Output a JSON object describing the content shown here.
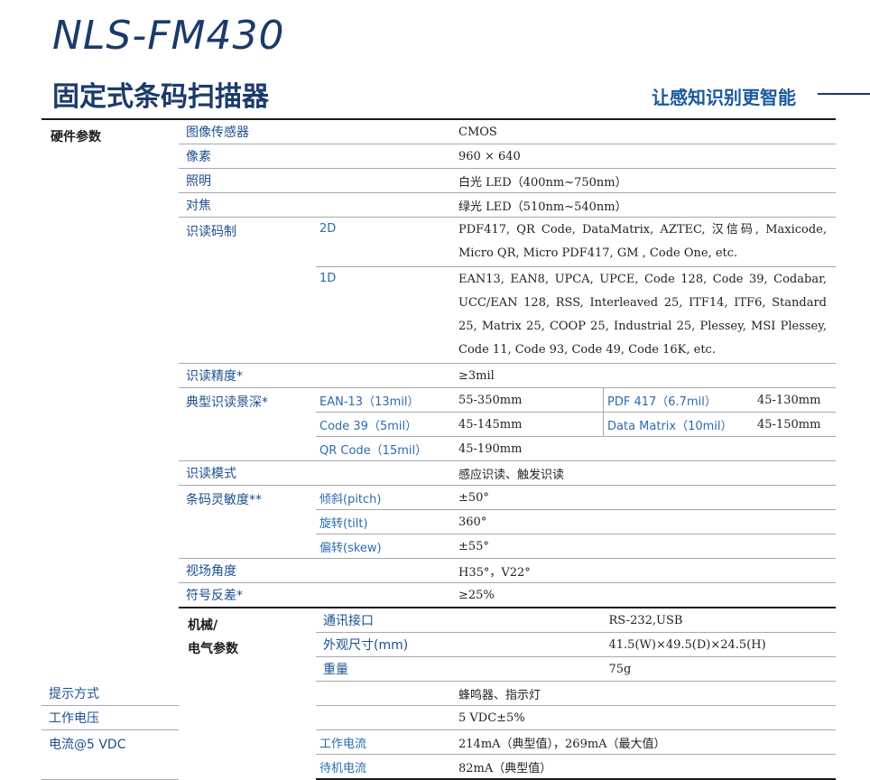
{
  "header": {
    "model": "NLS-FM430",
    "subtitle": "固定式条码扫描器",
    "slogan": "让感知识别更智能"
  },
  "groups": {
    "hardware": "硬件参数",
    "mech_line1": "机械/",
    "mech_line2": "电气参数"
  },
  "rows": {
    "sensor": {
      "label": "图像传感器",
      "value": "CMOS"
    },
    "pixels": {
      "label": "像素",
      "value": "960 × 640"
    },
    "illumination": {
      "label": "照明",
      "value": "白光 LED（400nm~750nm）"
    },
    "aiming": {
      "label": "对焦",
      "value": "绿光 LED（510nm~540nm）"
    },
    "symbologies": {
      "label": "识读码制",
      "sub2d": "2D",
      "value2d": "PDF417, QR Code, DataMatrix, AZTEC, 汉信码, Maxicode, Micro QR, Micro PDF417, GM , Code One, etc.",
      "sub1d": "1D",
      "value1d": "EAN13, EAN8, UPCA, UPCE, Code 128, Code 39, Codabar, UCC/EAN 128, RSS, Interleaved 25, ITF14, ITF6, Standard 25, Matrix 25, COOP 25, Industrial 25, Plessey, MSI Plessey, Code 11, Code 93, Code 49, Code 16K, etc."
    },
    "resolution": {
      "label": "识读精度*",
      "value": "≥3mil"
    },
    "dof": {
      "label": "典型识读景深*",
      "r1_sub": "EAN-13（13mil）",
      "r1_val": "55-350mm",
      "r1_sub_b": "PDF 417（6.7mil）",
      "r1_val_b": "45-130mm",
      "r2_sub": "Code 39（5mil）",
      "r2_val": "45-145mm",
      "r2_sub_b": "Data Matrix（10mil）",
      "r2_val_b": "45-150mm",
      "r3_sub": "QR Code（15mil）",
      "r3_val": "45-190mm"
    },
    "scan_mode": {
      "label": "识读模式",
      "value": "感应识读、触发识读"
    },
    "sensitivity": {
      "label": "条码灵敏度**",
      "pitch_sub": "倾斜(pitch)",
      "pitch_val": "±50°",
      "tilt_sub": "旋转(tilt)",
      "tilt_val": "360°",
      "skew_sub": "偏转(skew)",
      "skew_val": "±55°"
    },
    "fov": {
      "label": "视场角度",
      "value": "H35°，V22°"
    },
    "contrast": {
      "label": "符号反差*",
      "value": "≥25%"
    },
    "interface": {
      "label": "通讯接口",
      "value": "RS-232,USB"
    },
    "dimensions": {
      "label": "外观尺寸(mm)",
      "value": "41.5(W)×49.5(D)×24.5(H)"
    },
    "weight": {
      "label": "重量",
      "value": "75g"
    },
    "notification": {
      "label": "提示方式",
      "value": "蜂鸣器、指示灯"
    },
    "voltage": {
      "label": "工作电压",
      "value": "5 VDC±5%"
    },
    "current": {
      "label": "电流@5 VDC",
      "op_sub": "工作电流",
      "op_val": "214mA（典型值），269mA（最大值）",
      "standby_sub": "待机电流",
      "standby_val": "82mA（典型值）"
    }
  }
}
